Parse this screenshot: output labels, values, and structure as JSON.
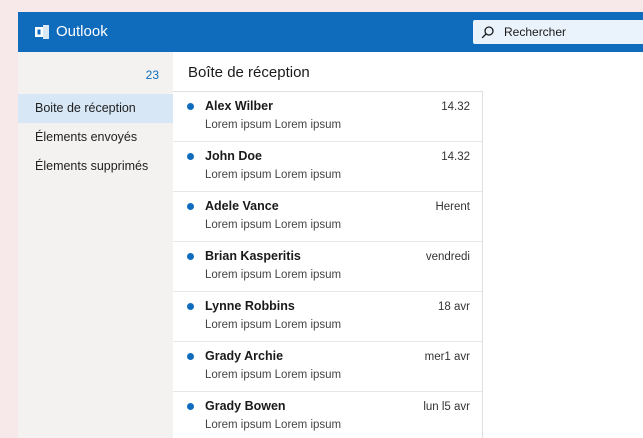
{
  "app": {
    "title": "Outlook",
    "icon": "outlook-logo-icon"
  },
  "search": {
    "label": "Rechercher",
    "icon": "search-icon"
  },
  "sidebar": {
    "unread_count": "23",
    "folders": [
      {
        "label": "Boite de réception",
        "selected": true
      },
      {
        "label": "Élements envoyés",
        "selected": false
      },
      {
        "label": "Élements supprimés",
        "selected": false
      }
    ]
  },
  "inbox": {
    "title": "Boîte de réception",
    "messages": [
      {
        "sender": "Alex Wilber",
        "preview": "Lorem ipsum Lorem ipsum",
        "time": "14.32",
        "unread": true
      },
      {
        "sender": "John Doe",
        "preview": "Lorem ipsum Lorem ipsum",
        "time": "14.32",
        "unread": true
      },
      {
        "sender": "Adele Vance",
        "preview": "Lorem ipsum Lorem ipsum",
        "time": "Herent",
        "unread": true
      },
      {
        "sender": "Brian Kasperitis",
        "preview": "Lorem ipsum Lorem ipsum",
        "time": "vendredi",
        "unread": true
      },
      {
        "sender": "Lynne Robbins",
        "preview": "Lorem ipsum Lorem ipsum",
        "time": "18 avr",
        "unread": true
      },
      {
        "sender": "Grady Archie",
        "preview": "Lorem ipsum Lorem ipsum",
        "time": "mer1 avr",
        "unread": true
      },
      {
        "sender": "Grady Bowen",
        "preview": "Lorem ipsum Lorem ipsum",
        "time": "lun l5 avr",
        "unread": true
      }
    ]
  },
  "colors": {
    "accent": "#0f6cbd",
    "sidebar_bg": "#f3f2f1",
    "selected_bg": "#d7e7f6",
    "page_bg": "#f7e9e9"
  }
}
